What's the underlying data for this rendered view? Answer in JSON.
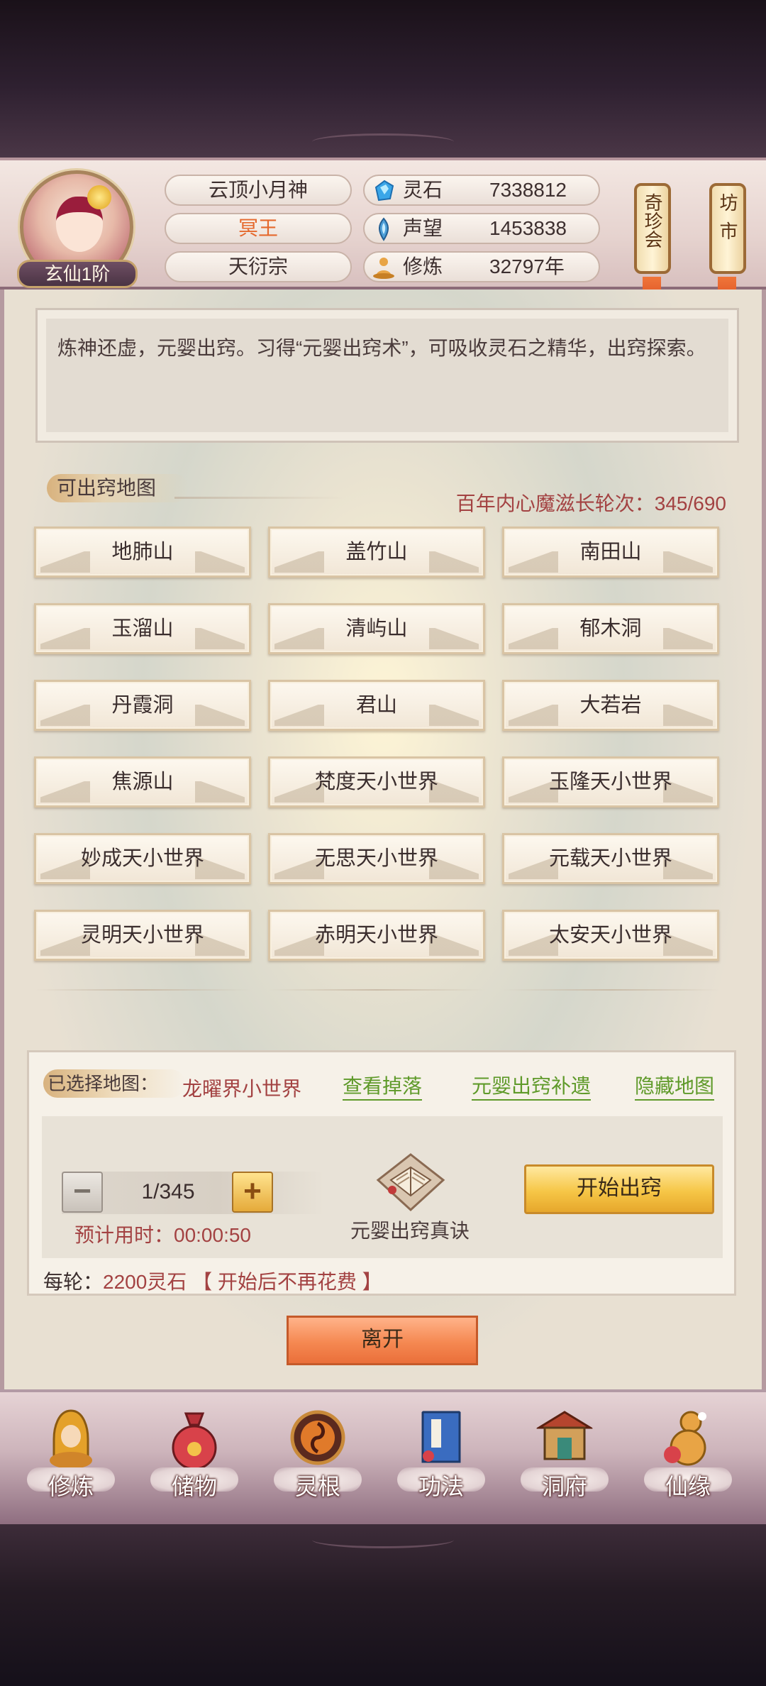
{
  "header": {
    "player_name": "云顶小月神",
    "title": "冥王",
    "sect": "天衍宗",
    "rank": "玄仙1阶",
    "stats": [
      {
        "icon": "spirit-stone-icon",
        "label": "灵石",
        "value": "7338812"
      },
      {
        "icon": "reputation-icon",
        "label": "声望",
        "value": "1453838"
      },
      {
        "icon": "cultivation-icon",
        "label": "修炼",
        "value": "32797年"
      }
    ],
    "banners": [
      "奇珍会",
      "坊市"
    ]
  },
  "description": "炼神还虚，元婴出窍。习得“元婴出窍术”，可吸收灵石之精华，出窍探索。",
  "map_section": {
    "title": "可出窍地图",
    "counter": "百年内心魔滋长轮次：345/690",
    "maps": [
      "地肺山",
      "盖竹山",
      "南田山",
      "玉溜山",
      "清屿山",
      "郁木洞",
      "丹霞洞",
      "君山",
      "大若岩",
      "焦源山",
      "梵度天小世界",
      "玉隆天小世界",
      "妙成天小世界",
      "无思天小世界",
      "元载天小世界",
      "灵明天小世界",
      "赤明天小世界",
      "太安天小世界"
    ]
  },
  "selection": {
    "label": "已选择地图：",
    "selected_map": "龙曜界小世界",
    "links": [
      "查看掉落",
      "元婴出窍补遗",
      "隐藏地图"
    ],
    "stepper_value": "1/345",
    "minus": "−",
    "plus": "+",
    "estimated_time": "预计用时：00:00:50",
    "book_label": "元婴出窍真诀",
    "start_button": "开始出窍",
    "cost_prefix": "每轮：",
    "cost_value": "2200灵石 【 开始后不再花费 】"
  },
  "leave_button": "离开",
  "bottom_nav": [
    {
      "label": "修炼",
      "icon": "meditation-icon"
    },
    {
      "label": "储物",
      "icon": "treasure-bag-icon"
    },
    {
      "label": "灵根",
      "icon": "spirit-root-icon"
    },
    {
      "label": "功法",
      "icon": "scripture-book-icon"
    },
    {
      "label": "洞府",
      "icon": "cave-mansion-icon"
    },
    {
      "label": "仙缘",
      "icon": "gourd-icon"
    }
  ]
}
